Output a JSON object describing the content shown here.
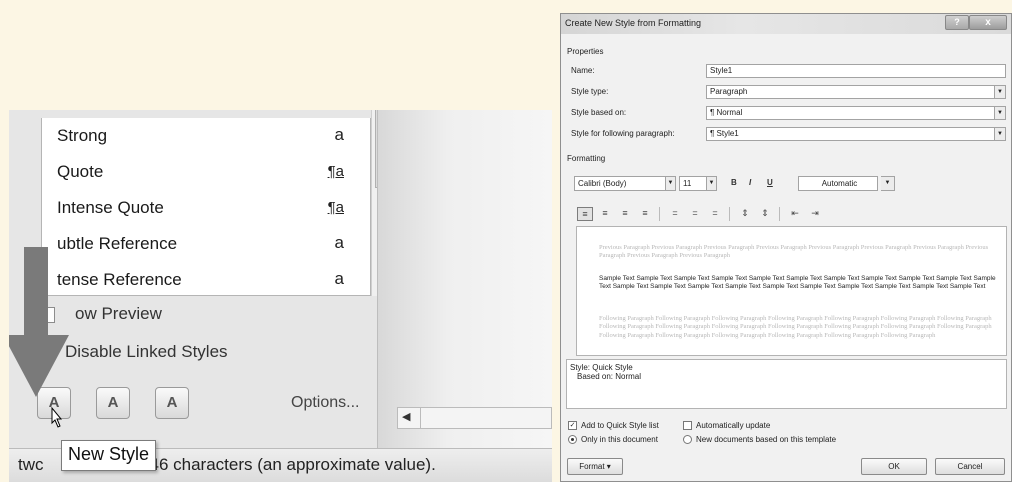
{
  "left_panel": {
    "styles": [
      {
        "label": "Strong",
        "glyph": "a",
        "underline": false
      },
      {
        "label": "Quote",
        "glyph": "¶a",
        "underline": true
      },
      {
        "label": "Intense Quote",
        "glyph": "¶a",
        "underline": true
      },
      {
        "label": "ubtle Reference",
        "glyph": "a",
        "underline": false
      },
      {
        "label": "tense Reference",
        "glyph": "a",
        "underline": false
      }
    ],
    "show_preview_label": "ow Preview",
    "disable_linked_label": "Disable Linked Styles",
    "options_label": "Options...",
    "status_text": "two New Style 46 characters (an approximate value).",
    "status_prefix": "twc",
    "status_suffix": "46 characters (an approximate value).",
    "tooltip": "New Style",
    "buttons": [
      {
        "icon": "new-style-icon",
        "glyph": "A"
      },
      {
        "icon": "style-inspector-icon",
        "glyph": "A"
      },
      {
        "icon": "manage-styles-icon",
        "glyph": "A"
      }
    ]
  },
  "dialog": {
    "title": "Create New Style from Formatting",
    "help": "?",
    "close": "x",
    "properties_label": "Properties",
    "name_label": "Name:",
    "name_value": "Style1",
    "style_type_label": "Style type:",
    "style_type_value": "Paragraph",
    "based_on_label": "Style based on:",
    "based_on_value": "¶ Normal",
    "following_label": "Style for following paragraph:",
    "following_value": "¶ Style1",
    "formatting_label": "Formatting",
    "font_value": "Calibri (Body)",
    "size_value": "11",
    "bold": "B",
    "italic": "I",
    "underline": "U",
    "color_value": "Automatic",
    "preview_previous": "Previous Paragraph Previous Paragraph Previous Paragraph Previous Paragraph Previous Paragraph Previous Paragraph Previous Paragraph Previous Paragraph Previous Paragraph Previous Paragraph",
    "preview_sample": "Sample Text Sample Text Sample Text Sample Text Sample Text Sample Text Sample Text Sample Text Sample Text Sample Text Sample Text Sample Text Sample Text Sample Text Sample Text Sample Text Sample Text Sample Text Sample Text Sample Text Sample Text",
    "preview_following": "Following Paragraph Following Paragraph Following Paragraph Following Paragraph Following Paragraph Following Paragraph Following Paragraph Following Paragraph Following Paragraph Following Paragraph Following Paragraph Following Paragraph Following Paragraph Following Paragraph Following Paragraph Following Paragraph Following Paragraph Following Paragraph Following Paragraph Following Paragraph",
    "desc_line1": "Style: Quick Style",
    "desc_line2": "Based on: Normal",
    "add_quick_label": "Add to Quick Style list",
    "auto_update_label": "Automatically update",
    "only_doc_label": "Only in this document",
    "new_docs_label": "New documents based on this template",
    "format_button": "Format ▾",
    "ok_button": "OK",
    "cancel_button": "Cancel"
  }
}
